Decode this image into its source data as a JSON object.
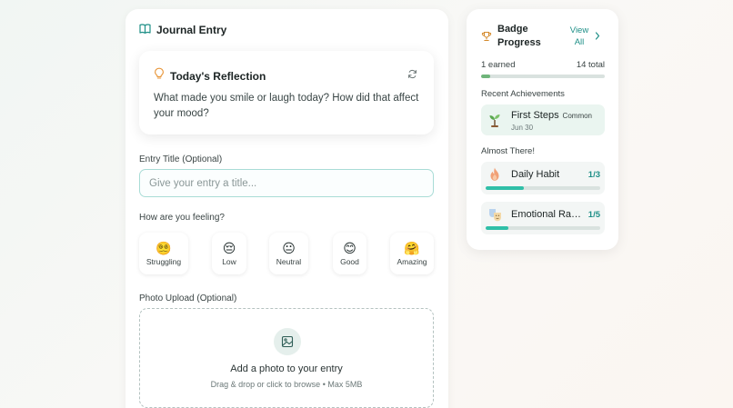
{
  "journal": {
    "header_title": "Journal Entry",
    "reflection": {
      "title": "Today's Reflection",
      "prompt": "What made you smile or laugh today? How did that affect your mood?"
    },
    "entry_title_label": "Entry Title (Optional)",
    "entry_title_placeholder": "Give your entry a title...",
    "entry_title_value": "",
    "feeling_label": "How are you feeling?",
    "moods": [
      {
        "emoji": "😵‍💫",
        "label": "Struggling"
      },
      {
        "emoji": "😔",
        "label": "Low"
      },
      {
        "emoji": "😐",
        "label": "Neutral"
      },
      {
        "emoji": "😊",
        "label": "Good"
      },
      {
        "emoji": "🤗",
        "label": "Amazing"
      }
    ],
    "photo_label": "Photo Upload (Optional)",
    "upload": {
      "title": "Add a photo to your entry",
      "subtitle": "Drag & drop or click to browse • Max 5MB"
    }
  },
  "badges": {
    "title": "Badge Progress",
    "view_all": "View All",
    "earned_text": "1 earned",
    "total_text": "14 total",
    "earned": 1,
    "total": 14,
    "recent_label": "Recent Achievements",
    "recent": [
      {
        "name": "First Steps",
        "rarity": "Common",
        "date": "Jun 30",
        "icon": "seedling-icon"
      }
    ],
    "almost_label": "Almost There!",
    "almost": [
      {
        "name": "Daily Habit",
        "progress_text": "1/3",
        "current": 1,
        "target": 3,
        "icon": "flame-icon"
      },
      {
        "name": "Emotional Range",
        "progress_text": "1/5",
        "current": 1,
        "target": 5,
        "icon": "theater-masks-icon"
      }
    ]
  },
  "colors": {
    "accent": "#1e8f87",
    "progress_green": "#6fb57a",
    "progress_teal": "#2fbfa8",
    "achievement_bg": "#eaf5f0"
  }
}
